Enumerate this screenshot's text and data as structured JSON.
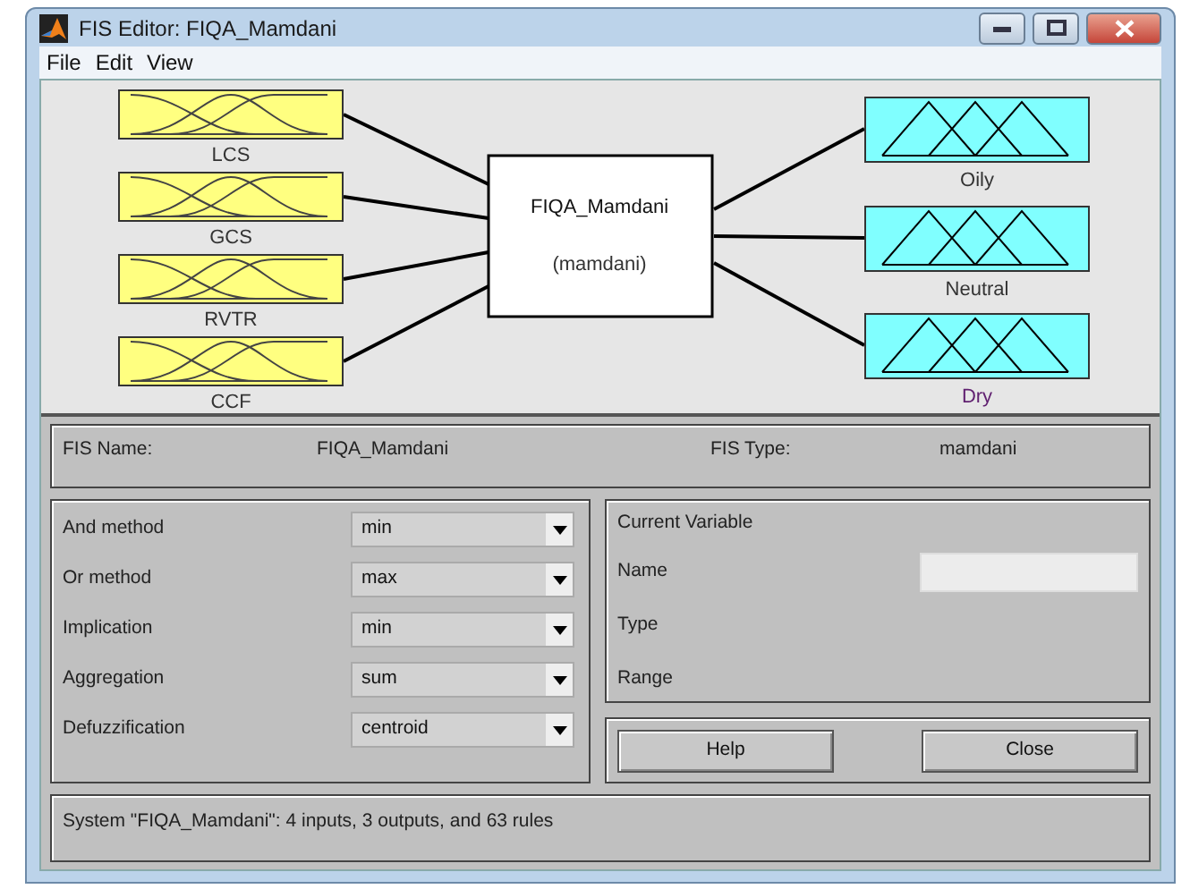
{
  "window": {
    "title": "FIS Editor: FIQA_Mamdani"
  },
  "menu": [
    {
      "label": "File"
    },
    {
      "label": "Edit"
    },
    {
      "label": "View"
    }
  ],
  "diagram": {
    "inputs": [
      {
        "name": "LCS"
      },
      {
        "name": "GCS"
      },
      {
        "name": "RVTR"
      },
      {
        "name": "CCF"
      }
    ],
    "system": {
      "name": "FIQA_Mamdani",
      "type": "(mamdani)"
    },
    "outputs": [
      {
        "name": "Oily"
      },
      {
        "name": "Neutral"
      },
      {
        "name": "Dry"
      }
    ]
  },
  "fis": {
    "name_label": "FIS Name:",
    "name": "FIQA_Mamdani",
    "type_label": "FIS Type:",
    "type": "mamdani"
  },
  "methods": [
    {
      "label": "And method",
      "value": "min"
    },
    {
      "label": "Or method",
      "value": "max"
    },
    {
      "label": "Implication",
      "value": "min"
    },
    {
      "label": "Aggregation",
      "value": "sum"
    },
    {
      "label": "Defuzzification",
      "value": "centroid"
    }
  ],
  "current_variable": {
    "title": "Current Variable",
    "rows": [
      {
        "label": "Name",
        "kind": "field"
      },
      {
        "label": "Type",
        "kind": "text"
      },
      {
        "label": "Range",
        "kind": "text"
      }
    ]
  },
  "buttons": [
    {
      "label": "Help"
    },
    {
      "label": "Close"
    }
  ],
  "status": "System \"FIQA_Mamdani\": 4 inputs, 3 outputs, and 63 rules"
}
